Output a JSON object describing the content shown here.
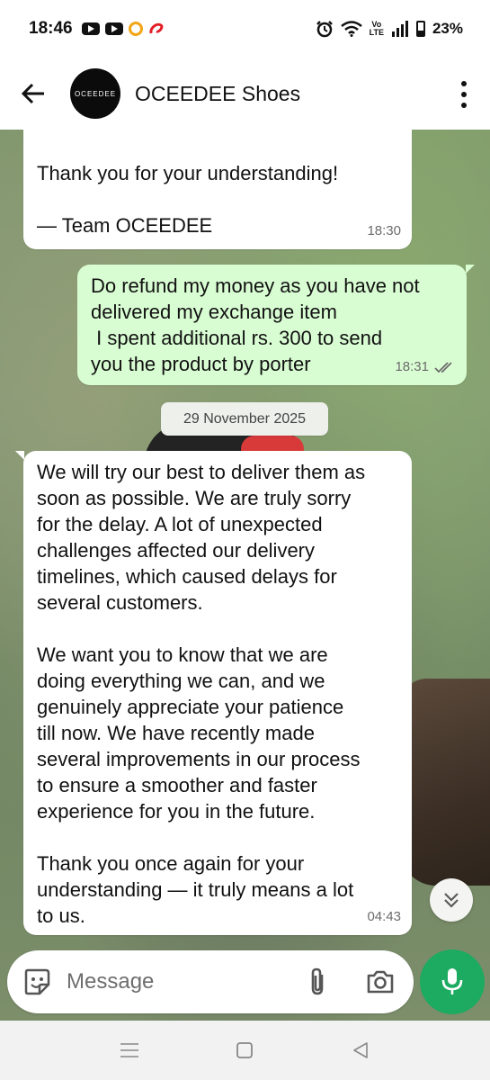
{
  "status_bar": {
    "time": "18:46",
    "volte_top": "Vo",
    "volte_bottom": "LTE",
    "battery": "23%"
  },
  "header": {
    "avatar_text": "OCEEDEE",
    "contact_name": "OCEEDEE Shoes"
  },
  "messages": [
    {
      "direction": "incoming",
      "text": "Thank you for your understanding!\n\n— Team OCEEDEE",
      "time": "18:30"
    },
    {
      "direction": "outgoing",
      "text": "Do refund my money as you have not\ndelivered my exchange item\n I spent additional rs. 300 to send\nyou the product by porter",
      "time": "18:31",
      "status": "read"
    },
    {
      "direction": "incoming",
      "text": "We will try our best to deliver them as\nsoon as possible. We are truly sorry\nfor the delay. A lot of unexpected\nchallenges affected our delivery\ntimelines, which caused delays for\nseveral customers.\n\nWe want you to know that we are\ndoing everything we can, and we\ngenuinely appreciate your patience\ntill now. We have recently made\nseveral improvements in our process\nto ensure a smoother and faster\nexperience for you in the future.\n\nThank you once again for your\nunderstanding — it truly means a lot\nto us.",
      "time": "04:43"
    }
  ],
  "date_separator": "29 November 2025",
  "composer": {
    "placeholder": "Message"
  },
  "colors": {
    "outgoing_bubble": "#d9fdd3",
    "incoming_bubble": "#ffffff",
    "mic_button": "#1daa61",
    "read_ticks": "#6b6b6b"
  },
  "icons": [
    "back-arrow-icon",
    "more-vert-icon",
    "sticker-icon",
    "attach-icon",
    "camera-icon",
    "mic-icon",
    "scroll-down-icon",
    "nav-recents-icon",
    "nav-home-icon",
    "nav-back-icon"
  ]
}
